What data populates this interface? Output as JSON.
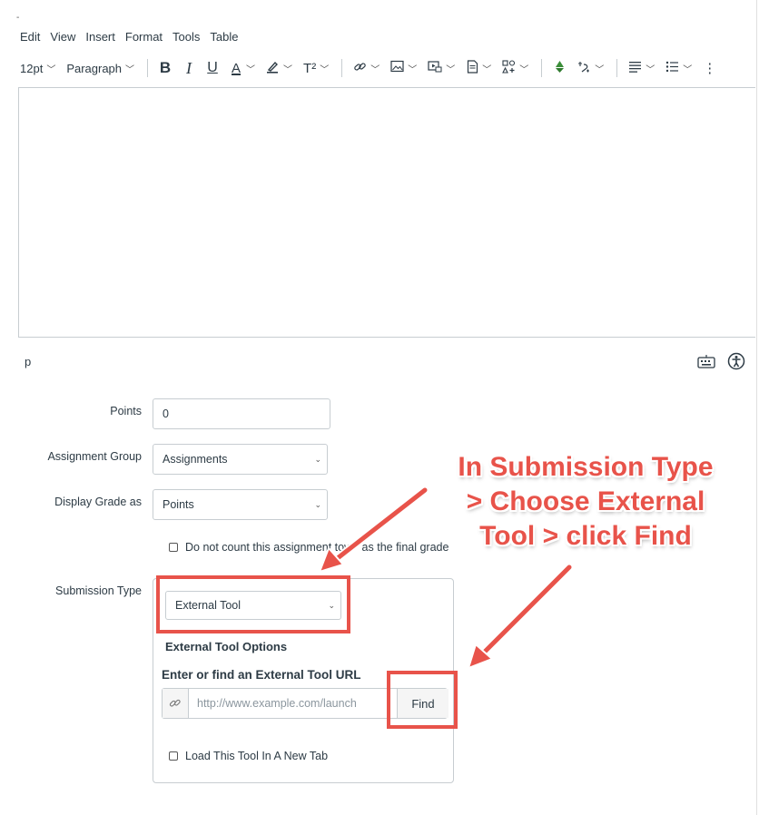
{
  "corner_mark": "-",
  "menubar": {
    "items": [
      "Edit",
      "View",
      "Insert",
      "Format",
      "Tools",
      "Table"
    ]
  },
  "toolbar": {
    "font_size": "12pt",
    "block_format": "Paragraph",
    "bold": "B",
    "italic": "I",
    "underline": "U",
    "text_color": "A",
    "superscript": "T²",
    "icons": [
      "link-icon",
      "image-icon",
      "media-icon",
      "document-icon",
      "apps-icon",
      "recycle-icon",
      "unlink-icon",
      "align-icon",
      "list-icon"
    ]
  },
  "editor": {
    "status_path": "p"
  },
  "form": {
    "points_label": "Points",
    "points_value": "0",
    "group_label": "Assignment Group",
    "group_value": "Assignments",
    "display_label": "Display Grade as",
    "display_value": "Points",
    "no_count_label": "Do not count this assignment tow   as the final grade",
    "submission_label": "Submission Type",
    "submission_value": "External Tool",
    "options_heading": "External Tool Options",
    "url_heading": "Enter or find an External Tool URL",
    "url_placeholder": "http://www.example.com/launch",
    "find_label": "Find",
    "new_tab_label": "Load This Tool In A New Tab"
  },
  "annotation": {
    "lines": [
      "In Submission Type",
      "> Choose External",
      "Tool > click Find"
    ],
    "color": "#e8534a"
  }
}
